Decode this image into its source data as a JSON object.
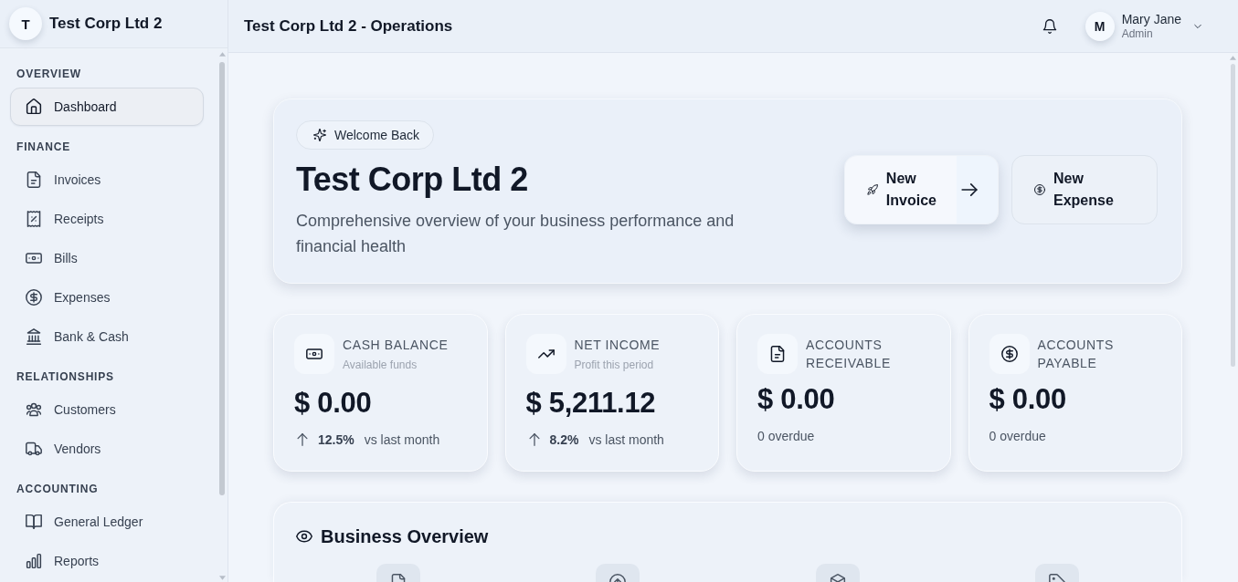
{
  "sidebar": {
    "brand": {
      "initial": "T",
      "name": "Test Corp Ltd 2"
    },
    "sections": [
      {
        "title": "OVERVIEW",
        "items": [
          {
            "label": "Dashboard",
            "selected": true
          }
        ]
      },
      {
        "title": "FINANCE",
        "items": [
          {
            "label": "Invoices",
            "selected": false
          },
          {
            "label": "Receipts",
            "selected": false
          },
          {
            "label": "Bills",
            "selected": false
          },
          {
            "label": "Expenses",
            "selected": false
          },
          {
            "label": "Bank & Cash",
            "selected": false
          }
        ]
      },
      {
        "title": "RELATIONSHIPS",
        "items": [
          {
            "label": "Customers",
            "selected": false
          },
          {
            "label": "Vendors",
            "selected": false
          }
        ]
      },
      {
        "title": "ACCOUNTING",
        "items": [
          {
            "label": "General Ledger",
            "selected": false
          },
          {
            "label": "Reports",
            "selected": false
          }
        ]
      }
    ]
  },
  "header": {
    "title": "Test Corp Ltd 2 - Operations",
    "user": {
      "initial": "M",
      "name": "Mary Jane",
      "role": "Admin"
    }
  },
  "hero": {
    "badge": "Welcome Back",
    "title": "Test Corp Ltd 2",
    "subtitle": "Comprehensive overview of your business performance and financial health",
    "actions": [
      {
        "label": "New Invoice",
        "kind": "primary"
      },
      {
        "label": "New Expense",
        "kind": "secondary"
      }
    ]
  },
  "stats": [
    {
      "kind": "trend",
      "label": "CASH BALANCE",
      "caption": "Available funds",
      "value": "$ 0.00",
      "change": "12.5%",
      "period": "vs last month"
    },
    {
      "kind": "trend",
      "label": "NET INCOME",
      "caption": "Profit this period",
      "value": "$ 5,211.12",
      "change": "8.2%",
      "period": "vs last month"
    },
    {
      "kind": "count",
      "label": "ACCOUNTS RECEIVABLE",
      "value": "$ 0.00",
      "note": "0 overdue"
    },
    {
      "kind": "count",
      "label": "ACCOUNTS PAYABLE",
      "value": "$ 0.00",
      "note": "0 overdue"
    }
  ],
  "overview": {
    "title": "Business Overview"
  }
}
